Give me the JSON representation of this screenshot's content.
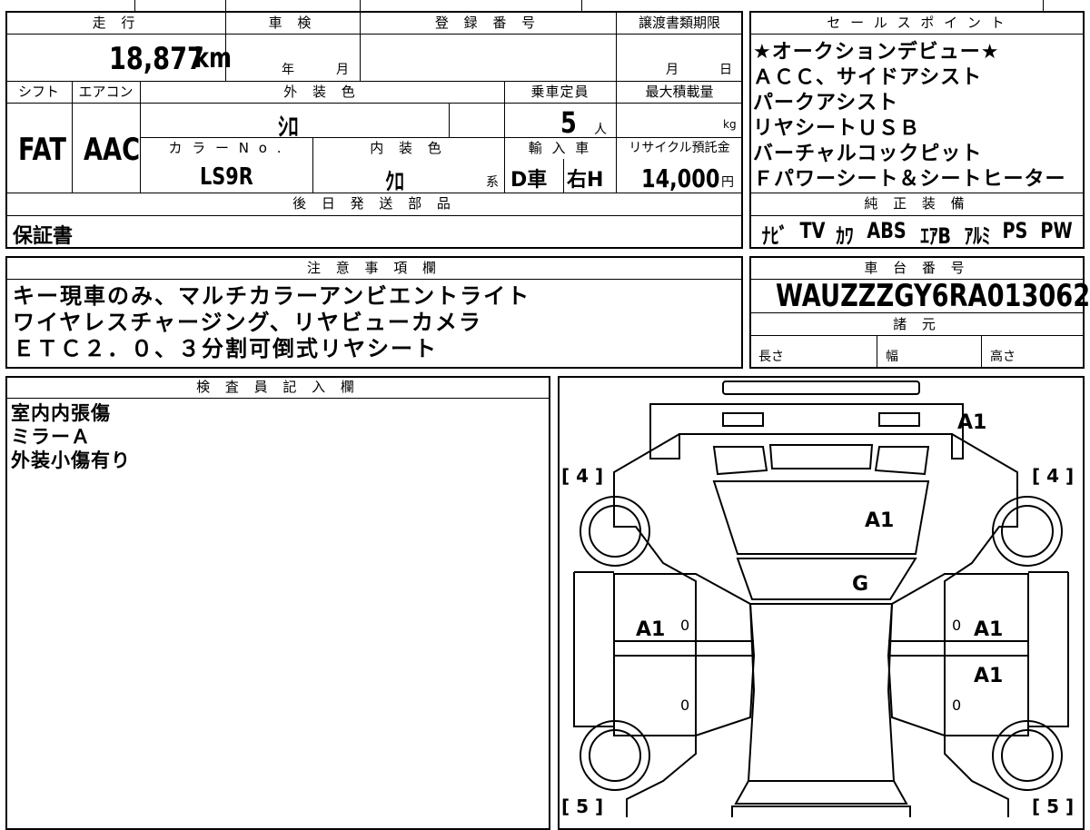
{
  "labels": {
    "mileage": "走 行",
    "inspection": "車 検",
    "registration": "登 録 番 号",
    "transfer_deadline": "譲渡書類期限",
    "sales_points": "セ ー ル ス ポ イ ン ト",
    "shift": "シフト",
    "aircon": "エアコン",
    "exterior_color": "外 装 色",
    "capacity": "乗車定員",
    "max_load": "最大積載量",
    "color_no": "カ ラ ー N o .",
    "interior_color": "内 装 色",
    "import": "輸 入 車",
    "recycle": "リサイクル預託金",
    "later_parts": "後 日 発 送 部 品",
    "notes": "注 意 事 項 欄",
    "chassis": "車 台 番 号",
    "specs": "諸 元",
    "genuine": "純 正 装 備",
    "inspector": "検 査 員 記 入 欄"
  },
  "vehicle": {
    "mileage_value": "18,877",
    "mileage_unit": "km",
    "year_unit": "年",
    "month_unit": "月",
    "deadline_month": "月",
    "deadline_day": "日",
    "shift": "FAT",
    "aircon": "AAC",
    "exterior_color": "ｼﾛ",
    "capacity": "5",
    "capacity_unit": "人",
    "max_load_unit": "kg",
    "color_no": "LS9R",
    "interior_color": "ｸﾛ",
    "interior_suffix": "系",
    "import_type": "D車",
    "steering": "右H",
    "recycle_fee": "14,000",
    "recycle_unit": "円",
    "later_parts": "保証書",
    "chassis_no": "WAUZZZGY6RA013062",
    "length_label": "長さ",
    "width_label": "幅",
    "height_label": "高さ"
  },
  "sales_points": [
    "★オークションデビュー★",
    "ＡＣＣ、サイドアシスト",
    "パークアシスト",
    "リヤシートＵＳＢ",
    "バーチャルコックピット",
    "Ｆパワーシート＆シートヒーター"
  ],
  "equipment": [
    "ﾅﾋﾞ",
    "TV",
    "ｶﾜ",
    "ABS",
    "ｴｱB",
    "ｱﾙﾐ",
    "PS",
    "PW"
  ],
  "notes": [
    "キー現車のみ、マルチカラーアンビエントライト",
    "ワイヤレスチャージング、リヤビューカメラ",
    "ＥＴＣ２．０、３分割可倒式リヤシート"
  ],
  "inspector_notes": [
    "室内内張傷",
    "ミラーＡ",
    "外装小傷有り"
  ],
  "diagram": {
    "marks": [
      "A1",
      "A1",
      "G",
      "A1",
      "A1",
      "A1"
    ],
    "tire_labels": [
      "[ 4 ]",
      "[ 4 ]",
      "[ 5 ]",
      "[ 5 ]"
    ],
    "tread": [
      "0",
      "0",
      "0",
      "0"
    ]
  }
}
